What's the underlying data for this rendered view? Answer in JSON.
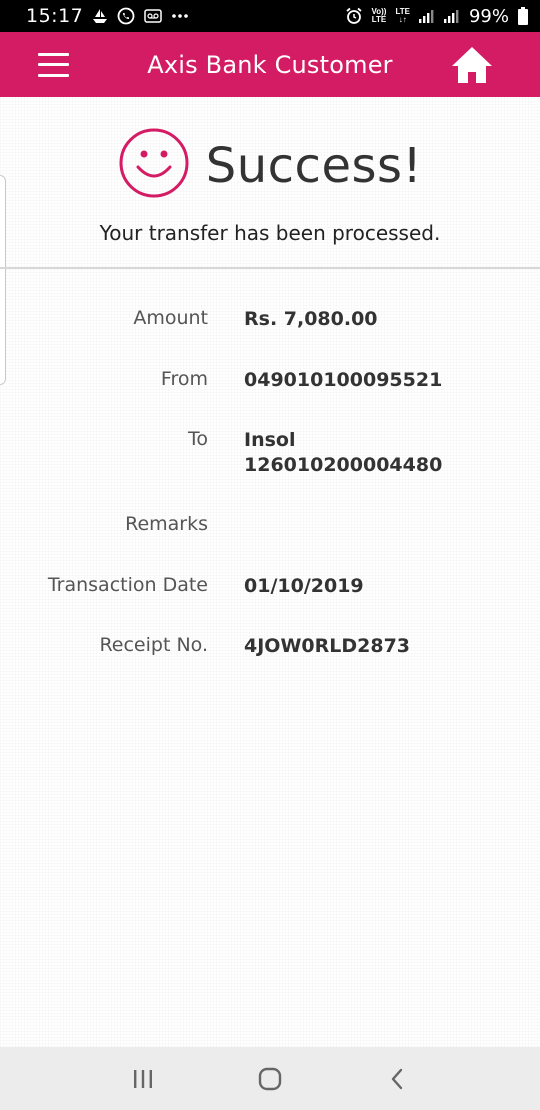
{
  "status_bar": {
    "time": "15:17",
    "left_icons": [
      "boat-notification-icon",
      "whatsapp-call-icon",
      "voicemail-icon",
      "more-notifications-icon"
    ],
    "volte_top": "Vo))",
    "volte_bottom": "LTE",
    "lte_label": "LTE",
    "battery_percent": "99%"
  },
  "app_bar": {
    "title": "Axis Bank Customer",
    "color": "#d41c64"
  },
  "success": {
    "title": "Success!",
    "subtitle": "Your transfer has been processed.",
    "icon_color": "#d41c64"
  },
  "details": [
    {
      "label": "Amount",
      "value_lines": [
        "Rs. 7,080.00"
      ]
    },
    {
      "label": "From",
      "value_lines": [
        "049010100095521"
      ]
    },
    {
      "label": "To",
      "value_lines": [
        "Insol",
        "126010200004480"
      ]
    },
    {
      "label": "Remarks",
      "value_lines": []
    },
    {
      "label": "Transaction Date",
      "value_lines": [
        "01/10/2019"
      ]
    },
    {
      "label": "Receipt No.",
      "value_lines": [
        "4JOW0RLD2873"
      ]
    }
  ],
  "nav_bar": {
    "buttons": [
      "recent-apps",
      "home",
      "back"
    ]
  }
}
